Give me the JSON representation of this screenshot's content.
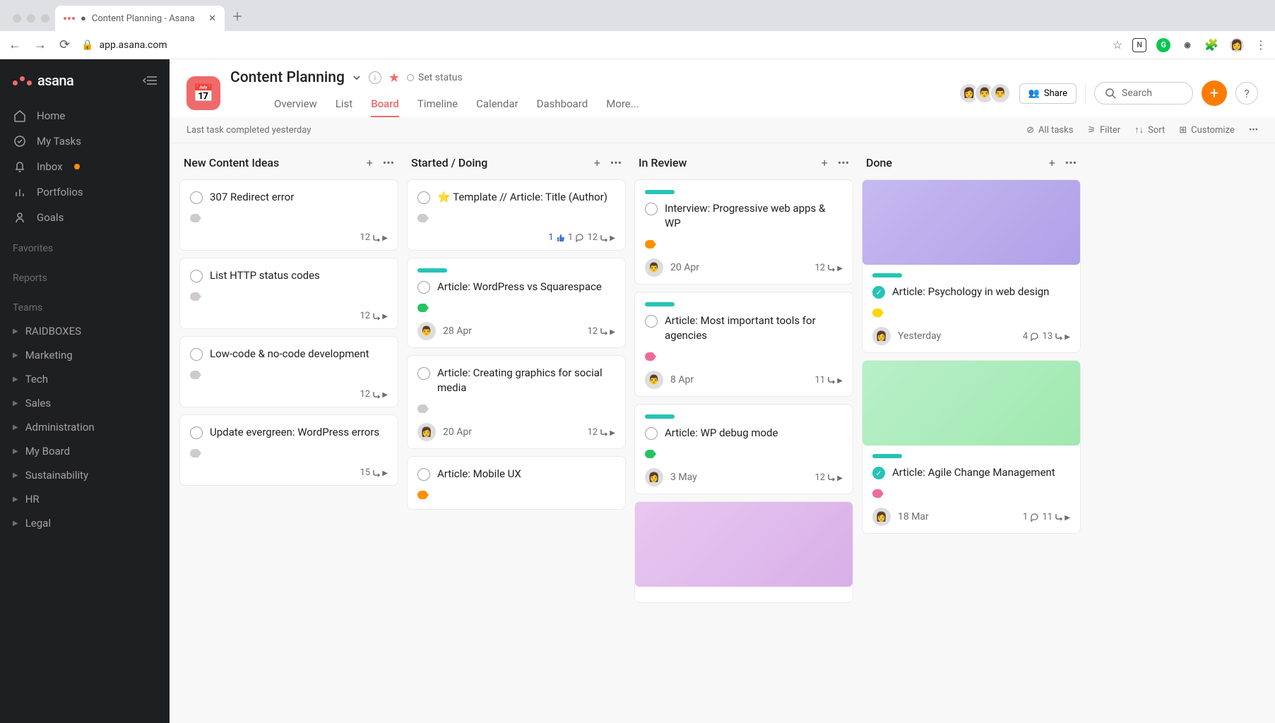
{
  "browser": {
    "tab_title": "Content Planning - Asana",
    "url": "app.asana.com"
  },
  "sidebar": {
    "logo": "asana",
    "nav": {
      "home": "Home",
      "my_tasks": "My Tasks",
      "inbox": "Inbox",
      "portfolios": "Portfolios",
      "goals": "Goals"
    },
    "sections": {
      "favorites": "Favorites",
      "reports": "Reports",
      "teams": "Teams"
    },
    "teams": [
      "RAIDBOXES",
      "Marketing",
      "Tech",
      "Sales",
      "Administration",
      "My Board",
      "Sustainability",
      "HR",
      "Legal"
    ]
  },
  "header": {
    "title": "Content Planning",
    "set_status": "Set status",
    "share": "Share",
    "search_placeholder": "Search",
    "tabs": [
      "Overview",
      "List",
      "Board",
      "Timeline",
      "Calendar",
      "Dashboard",
      "More..."
    ],
    "active_tab": "Board"
  },
  "toolbar": {
    "status": "Last task completed yesterday",
    "all_tasks": "All tasks",
    "filter": "Filter",
    "sort": "Sort",
    "customize": "Customize"
  },
  "columns": [
    {
      "title": "New Content Ideas",
      "cards": [
        {
          "title": "307 Redirect error",
          "tag": "gray",
          "subtasks": "12"
        },
        {
          "title": "List HTTP status codes",
          "tag": "gray",
          "subtasks": "12"
        },
        {
          "title": "Low-code & no-code development",
          "tag": "gray",
          "subtasks": "12"
        },
        {
          "title": "Update evergreen: WordPress errors",
          "tag": "gray",
          "subtasks": "15"
        }
      ]
    },
    {
      "title": "Started / Doing",
      "cards": [
        {
          "title": "⭐ Template // Article: Title (Author)",
          "tag": "gray",
          "likes": "1",
          "comments": "1",
          "subtasks": "12"
        },
        {
          "bar": "teal",
          "title": "Article: WordPress vs Squarespace",
          "tag": "green",
          "avatar": "👨",
          "date": "28 Apr",
          "subtasks": "12"
        },
        {
          "title": "Article: Creating graphics for social media",
          "tag": "gray",
          "avatar": "👩",
          "date": "20 Apr",
          "subtasks": "12"
        },
        {
          "title": "Article: Mobile UX",
          "tag": "orange"
        }
      ]
    },
    {
      "title": "In Review",
      "cards": [
        {
          "bar": "teal",
          "title": "Interview: Progressive web apps & WP",
          "tag": "orange",
          "avatar": "👨",
          "date": "20 Apr",
          "subtasks": "12"
        },
        {
          "bar": "teal",
          "title": "Article: Most important tools for agencies",
          "tag": "pink",
          "avatar": "👨",
          "date": "8 Apr",
          "subtasks": "11"
        },
        {
          "bar": "teal",
          "title": "Article: WP debug mode",
          "tag": "green",
          "avatar": "👩",
          "date": "3 May",
          "subtasks": "12"
        },
        {
          "image": "purple2"
        }
      ]
    },
    {
      "title": "Done",
      "cards": [
        {
          "image": "purple",
          "bar": "teal",
          "done": true,
          "title": "Article: Psychology in web design",
          "tag": "yellow",
          "avatar": "👩",
          "date": "Yesterday",
          "comments": "4",
          "subtasks": "13"
        },
        {
          "image": "green",
          "bar": "teal",
          "done": true,
          "title": "Article: Agile Change Management",
          "tag": "pink",
          "avatar": "👩",
          "date": "18 Mar",
          "comments": "1",
          "subtasks": "11"
        }
      ]
    }
  ]
}
